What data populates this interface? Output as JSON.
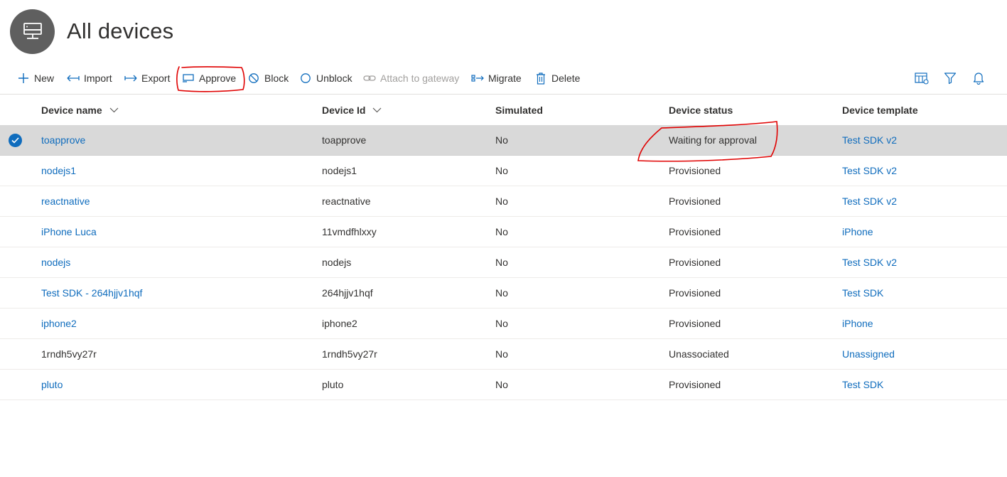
{
  "header": {
    "title": "All devices",
    "icon": "device-icon"
  },
  "toolbar": {
    "new_label": "New",
    "import_label": "Import",
    "export_label": "Export",
    "approve_label": "Approve",
    "block_label": "Block",
    "unblock_label": "Unblock",
    "attach_label": "Attach to gateway",
    "migrate_label": "Migrate",
    "delete_label": "Delete"
  },
  "table": {
    "columns": [
      "Device name",
      "Device Id",
      "Simulated",
      "Device status",
      "Device template"
    ],
    "rows": [
      {
        "name": "toapprove",
        "id": "toapprove",
        "simulated": "No",
        "status": "Waiting for approval",
        "template": "Test SDK v2",
        "selected": true,
        "name_link": true
      },
      {
        "name": "nodejs1",
        "id": "nodejs1",
        "simulated": "No",
        "status": "Provisioned",
        "template": "Test SDK v2",
        "name_link": true
      },
      {
        "name": "reactnative",
        "id": "reactnative",
        "simulated": "No",
        "status": "Provisioned",
        "template": "Test SDK v2",
        "name_link": true
      },
      {
        "name": "iPhone Luca",
        "id": "11vmdfhlxxy",
        "simulated": "No",
        "status": "Provisioned",
        "template": "iPhone",
        "name_link": true
      },
      {
        "name": "nodejs",
        "id": "nodejs",
        "simulated": "No",
        "status": "Provisioned",
        "template": "Test SDK v2",
        "name_link": true
      },
      {
        "name": "Test SDK - 264hjjv1hqf",
        "id": "264hjjv1hqf",
        "simulated": "No",
        "status": "Provisioned",
        "template": "Test SDK",
        "name_link": true
      },
      {
        "name": "iphone2",
        "id": "iphone2",
        "simulated": "No",
        "status": "Provisioned",
        "template": "iPhone",
        "name_link": true
      },
      {
        "name": "1rndh5vy27r",
        "id": "1rndh5vy27r",
        "simulated": "No",
        "status": "Unassociated",
        "template": "Unassigned",
        "name_link": false
      },
      {
        "name": "pluto",
        "id": "pluto",
        "simulated": "No",
        "status": "Provisioned",
        "template": "Test SDK",
        "name_link": true
      }
    ]
  },
  "colors": {
    "accent": "#0f6cbd",
    "selected_row": "#d9d9d9",
    "annotation": "#e00000"
  }
}
